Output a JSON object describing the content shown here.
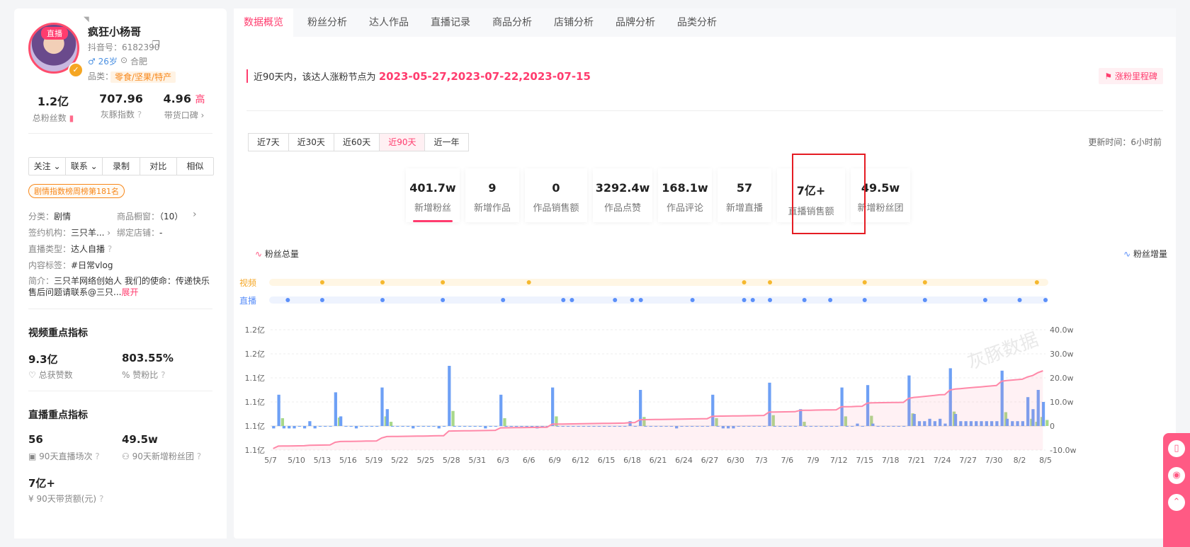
{
  "profile": {
    "live_tag": "直播",
    "name": "疯狂小杨哥",
    "douyin_id": "抖音号：6182390",
    "gender_age": "♂ 26岁",
    "location": "合肥",
    "category_label": "品类：",
    "category": "零食/坚果/特产",
    "stats": [
      {
        "value": "1.2亿",
        "label": "总粉丝数"
      },
      {
        "value": "707.96",
        "label": "灰豚指数"
      },
      {
        "value": "4.96",
        "extra": "高",
        "label": "带货口碑 ›"
      }
    ],
    "buttons": [
      "关注 ⌄",
      "联系 ⌄",
      "录制",
      "对比",
      "相似"
    ],
    "rank_badge": "剧情指数榜周榜第181名",
    "info": {
      "category": "分类：",
      "category_val": "剧情",
      "showcase": "商品橱窗：",
      "showcase_val": "（10）",
      "agency": "签约机构：",
      "agency_val": "三只羊...",
      "shop": "绑定店铺：",
      "shop_val": "-",
      "live_type": "直播类型：",
      "live_type_val": "达人自播",
      "content_tag": "内容标签：",
      "content_tag_val": "#日常vlog",
      "intro_label": "简介：",
      "intro_line1": "三只羊网络创始人 我们的使命：传递快乐",
      "intro_line2": "售后问题请联系@三只...",
      "expand": "展开"
    },
    "video_metrics": {
      "title": "视频重点指标",
      "likes": "9.3亿",
      "likes_label": "总获赞数",
      "ratio": "803.55%",
      "ratio_label": "赞粉比"
    },
    "live_metrics": {
      "title": "直播重点指标",
      "sessions": "56",
      "sessions_label": "90天直播场次",
      "fans_group": "49.5w",
      "fans_group_label": "90天新增粉丝团",
      "gmv": "7亿+",
      "gmv_label": "90天带货额(元)"
    }
  },
  "tabs": [
    "数据概览",
    "粉丝分析",
    "达人作品",
    "直播记录",
    "商品分析",
    "店铺分析",
    "品牌分析",
    "品类分析"
  ],
  "notice": {
    "prefix": "近90天内，该达人涨粉节点为 ",
    "dates": "2023-05-27,2023-07-22,2023-07-15",
    "milestone": "涨粉里程碑"
  },
  "periods": [
    "近7天",
    "近30天",
    "近60天",
    "近90天",
    "近一年"
  ],
  "active_period": "近90天",
  "update_time": "更新时间：6小时前",
  "cards": [
    {
      "value": "401.7w",
      "label": "新增粉丝"
    },
    {
      "value": "9",
      "label": "新增作品"
    },
    {
      "value": "0",
      "label": "作品销售额"
    },
    {
      "value": "3292.4w",
      "label": "作品点赞"
    },
    {
      "value": "168.1w",
      "label": "作品评论"
    },
    {
      "value": "57",
      "label": "新增直播"
    },
    {
      "value": "7亿+",
      "label": "直播销售额"
    },
    {
      "value": "49.5w",
      "label": "新增粉丝团"
    }
  ],
  "legend": {
    "total": "粉丝总量",
    "increment": "粉丝增量",
    "video": "视频",
    "live": "直播"
  },
  "watermark": "灰豚数据",
  "colors": {
    "accent": "#ff3c6e",
    "bar_blue": "#6ea0f5",
    "bar_green": "#a8d88a",
    "line_pink": "#ff88a8",
    "video_dot": "#f5b82e",
    "live_dot": "#5b8ff9"
  },
  "chart_data": {
    "type": "bar",
    "x": [
      "5/7",
      "5/10",
      "5/13",
      "5/16",
      "5/19",
      "5/22",
      "5/25",
      "5/28",
      "5/31",
      "6/3",
      "6/6",
      "6/9",
      "6/12",
      "6/15",
      "6/18",
      "6/21",
      "6/24",
      "6/27",
      "6/30",
      "7/3",
      "7/6",
      "7/9",
      "7/12",
      "7/15",
      "7/18",
      "7/21",
      "7/24",
      "7/27",
      "7/30",
      "8/2",
      "8/5"
    ],
    "yleft_ticks": [
      "1.1亿",
      "1.1亿",
      "1.1亿",
      "1.1亿",
      "1.2亿",
      "1.2亿"
    ],
    "yright_ticks": [
      "-10.0w",
      "0",
      "10.0w",
      "20.0w",
      "30.0w",
      "40.0w"
    ],
    "yright_range": [
      -10,
      40
    ],
    "series": [
      {
        "name": "粉丝增量",
        "values": [
          -1,
          13,
          -1,
          -1,
          -1,
          0,
          -1,
          2,
          -1,
          0,
          0,
          0,
          14,
          4,
          0,
          0,
          -1,
          0,
          0,
          0,
          0,
          16,
          7,
          0,
          0,
          0,
          0,
          -1,
          0,
          0,
          0,
          0,
          -1,
          0,
          25,
          0,
          0,
          0,
          0,
          0,
          0,
          -1,
          0,
          0,
          13,
          0,
          0,
          0,
          0,
          0,
          0,
          -1,
          0,
          0,
          16,
          0,
          0,
          0,
          0,
          0,
          0,
          0,
          0,
          0,
          0,
          0,
          0,
          0,
          0,
          2,
          0,
          15,
          0,
          0,
          0,
          0,
          0,
          0,
          -1,
          0,
          0,
          0,
          0,
          0,
          0,
          13,
          0,
          -1,
          -1,
          -1,
          0,
          0,
          0,
          0,
          0,
          0,
          18,
          0,
          0,
          0,
          0,
          0,
          7,
          0,
          0,
          0,
          0,
          0,
          0,
          0,
          16,
          0,
          0,
          1,
          0,
          17,
          1,
          0,
          0,
          0,
          0,
          0,
          0,
          21,
          5,
          2,
          2,
          3,
          2,
          3,
          1,
          24,
          5,
          2,
          2,
          2,
          2,
          2,
          2,
          2,
          2,
          23,
          3,
          2,
          2,
          2,
          12,
          7,
          15,
          10
        ]
      },
      {
        "name": "粉丝总量",
        "values": []
      },
      {
        "name": "视频",
        "dates": [
          "5/13",
          "5/20",
          "5/27",
          "6/6",
          "7/1",
          "7/4",
          "7/15",
          "7/22",
          "8/4"
        ]
      },
      {
        "name": "直播",
        "dates": [
          "5/9",
          "5/13",
          "5/20",
          "5/27",
          "6/3",
          "6/10",
          "6/11",
          "6/16",
          "6/18",
          "6/19",
          "6/25",
          "7/1",
          "7/2",
          "7/4",
          "7/8",
          "7/11",
          "7/15",
          "7/22",
          "7/29",
          "8/2",
          "8/5"
        ]
      }
    ]
  }
}
